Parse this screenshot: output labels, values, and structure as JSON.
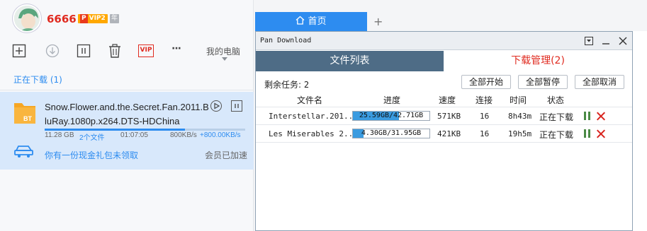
{
  "user": {
    "name": "6666",
    "vip_p": "P",
    "vip_label": "VIP2",
    "year_badge": "年"
  },
  "toolbar": {
    "icons": [
      "new-task-icon",
      "download-icon",
      "pause-icon",
      "trash-icon",
      "vip-icon",
      "more-icon"
    ],
    "vip_text": "VIP",
    "more_text": "···",
    "my_pc": "我的电脑"
  },
  "downloading": {
    "title": "正在下载 (1)",
    "item": {
      "icon_text": "BT",
      "name": "Snow.Flower.and.the.Secret.Fan.2011.BluRay.1080p.x264.DTS-HDChina",
      "progress": 0.7,
      "size": "11.28 GB",
      "files": "2个文件",
      "time": "01:07:05",
      "speed": "800KB/s",
      "boost": "+800.00KB/s"
    },
    "promo": "你有一份现金礼包未领取",
    "promo_right": "会员已加速"
  },
  "tabs": {
    "home": "首页",
    "plus": "+"
  },
  "dialog": {
    "title": "Pan Download",
    "tab_list": "文件列表",
    "tab_manager": "下载管理(2)",
    "remaining_label": "剩余任务:",
    "remaining_count": "2",
    "buttons": {
      "start_all": "全部开始",
      "pause_all": "全部暂停",
      "cancel_all": "全部取消"
    },
    "columns": [
      "文件名",
      "进度",
      "速度",
      "连接",
      "时间",
      "状态"
    ],
    "rows": [
      {
        "name": "Interstellar.201...",
        "progress_text": "25.59GB/42.71GB",
        "progress": 0.599,
        "speed": "571KB",
        "connections": "16",
        "time": "8h43m",
        "status": "正在下载"
      },
      {
        "name": "Les Miserables 2...",
        "progress_text": "4.30GB/31.95GB",
        "progress": 0.135,
        "speed": "421KB",
        "connections": "16",
        "time": "19h5m",
        "status": "正在下载"
      }
    ]
  },
  "colors": {
    "accent": "#2d8cf0",
    "red": "#e02b20",
    "tab_dark": "#4e6c86",
    "selected_row": "#d8e8fb"
  }
}
